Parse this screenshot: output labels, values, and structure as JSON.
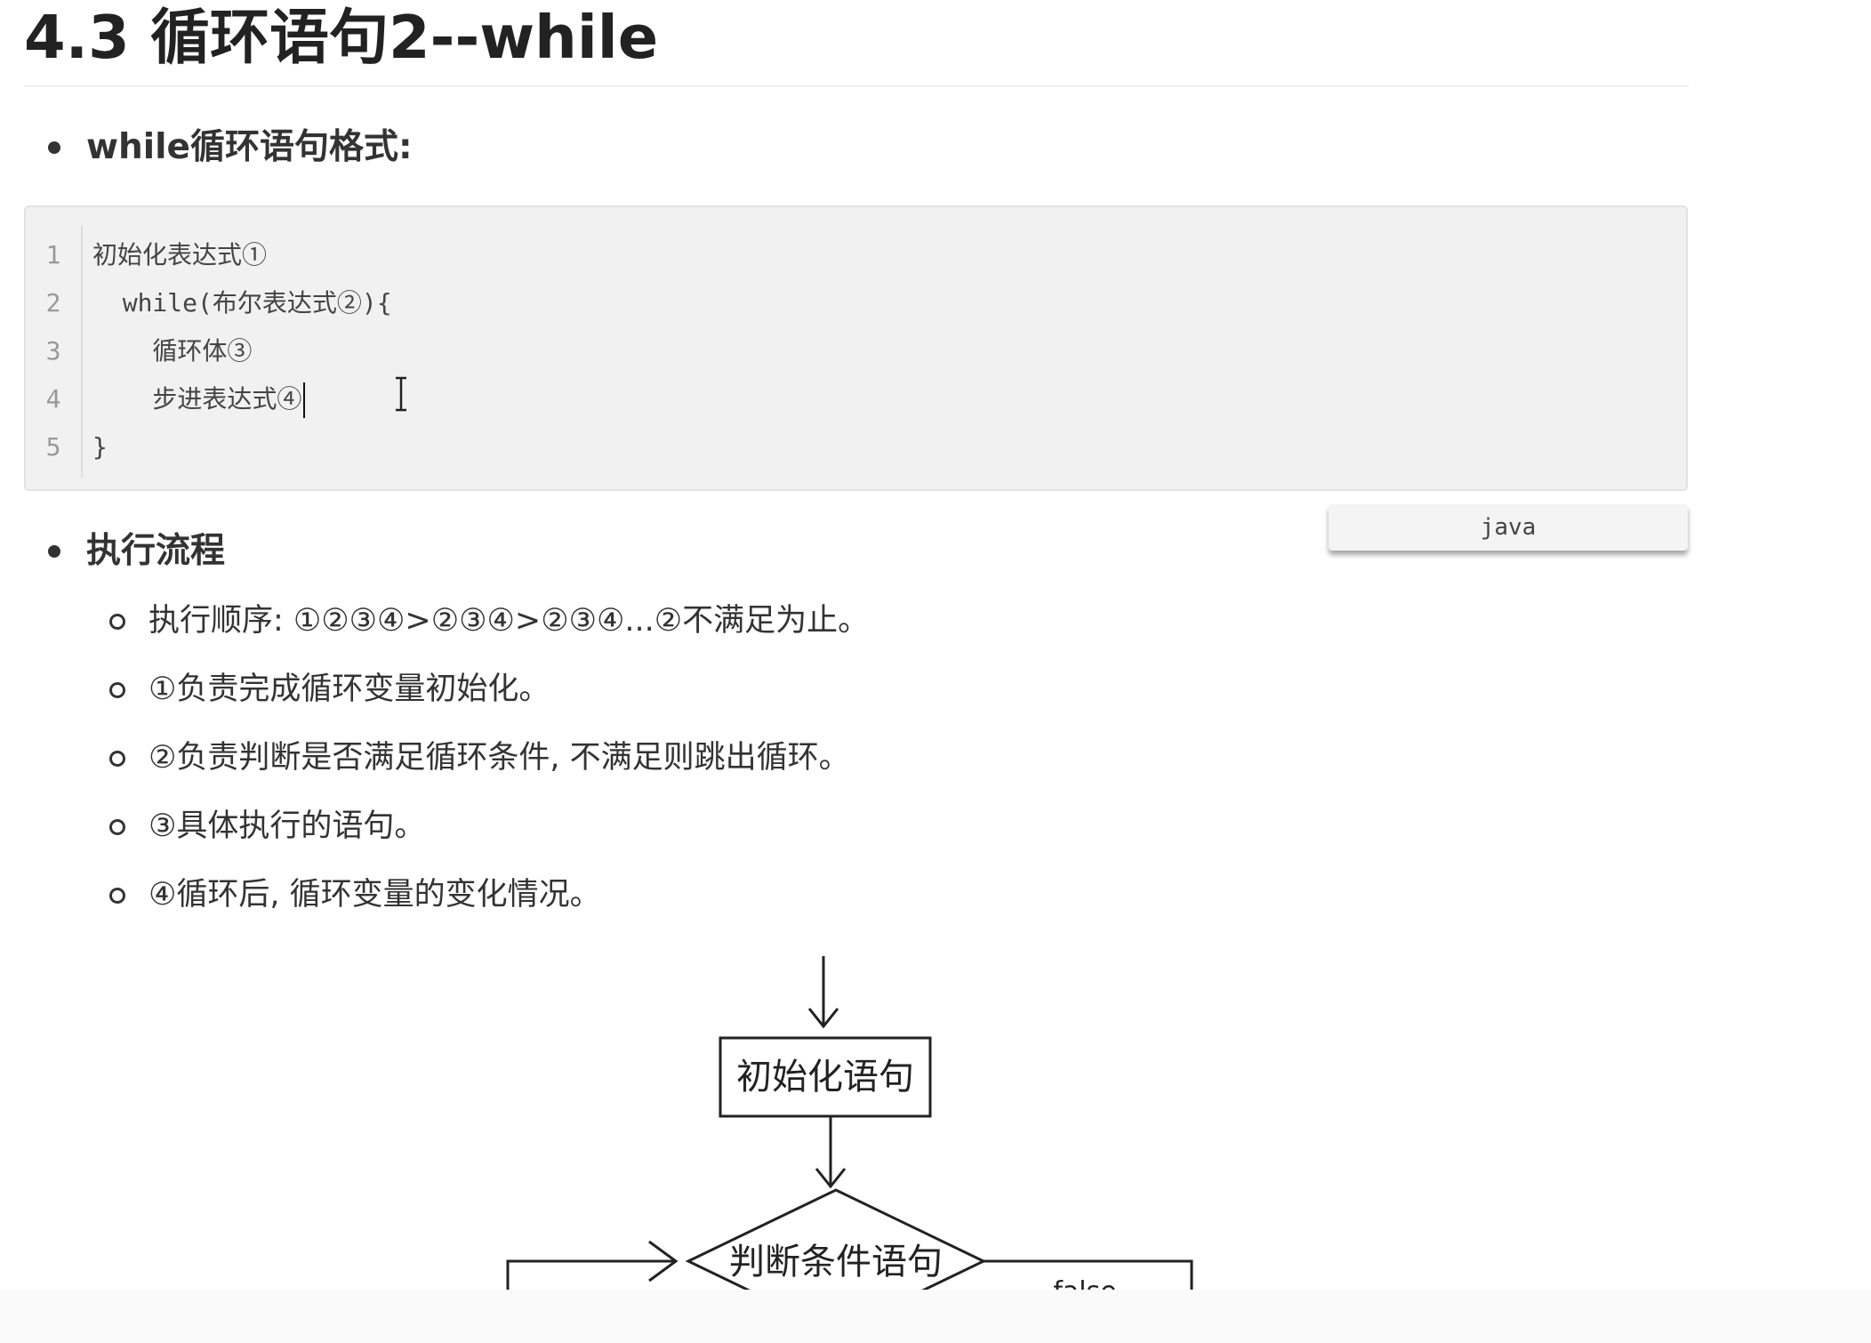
{
  "title": "4.3 循环语句2--while",
  "section_format": {
    "heading": "while循环语句格式:",
    "code_lines": [
      {
        "no": "1",
        "text": "初始化表达式①"
      },
      {
        "no": "2",
        "text": "  while(布尔表达式②){"
      },
      {
        "no": "3",
        "text": "    循环体③"
      },
      {
        "no": "4",
        "text": "    步进表达式④"
      },
      {
        "no": "5",
        "text": "}"
      }
    ],
    "language_label": "java"
  },
  "section_flow": {
    "heading": "执行流程",
    "items": [
      "执行顺序: ①②③④>②③④>②③④...②不满足为止。",
      "①负责完成循环变量初始化。",
      "②负责判断是否满足循环条件, 不满足则跳出循环。",
      "③具体执行的语句。",
      "④循环后, 循环变量的变化情况。"
    ]
  },
  "flowchart": {
    "init_label": "初始化语句",
    "condition_label": "判断条件语句",
    "false_label": "false"
  }
}
